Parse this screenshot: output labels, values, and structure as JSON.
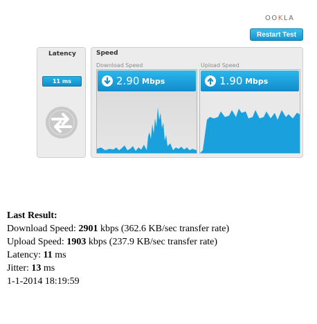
{
  "brand": {
    "prefix": "OO",
    "x": "K",
    "suffix": "LA"
  },
  "restart_label": "Restart Test",
  "latency": {
    "title": "Latency",
    "value": "11 ms"
  },
  "speed": {
    "title": "Speed",
    "download": {
      "label": "Download Speed",
      "value": "2.90",
      "unit": "Mbps"
    },
    "upload": {
      "label": "Upload Speed",
      "value": "1.90",
      "unit": "Mbps"
    }
  },
  "colors": {
    "accent": "#1ba3dd",
    "graph_fill": "#1aa0dc",
    "panel_bg": "#ececec"
  },
  "icons": {
    "latency": "latency-arrows-icon",
    "download": "download-arrow-icon",
    "upload": "upload-arrow-icon"
  },
  "result": {
    "title": "Last Result:",
    "download_label": "Download Speed: ",
    "download_value": "2901",
    "download_rest": " kbps (362.6 KB/sec transfer rate)",
    "upload_label": "Upload Speed: ",
    "upload_value": "1903",
    "upload_rest": " kbps (237.9 KB/sec transfer rate)",
    "latency_label": "Latency: ",
    "latency_value": "11",
    "latency_rest": " ms",
    "jitter_label": "Jitter: ",
    "jitter_value": "13",
    "jitter_rest": " ms",
    "timestamp": "1-1-2014 18:19:59"
  }
}
